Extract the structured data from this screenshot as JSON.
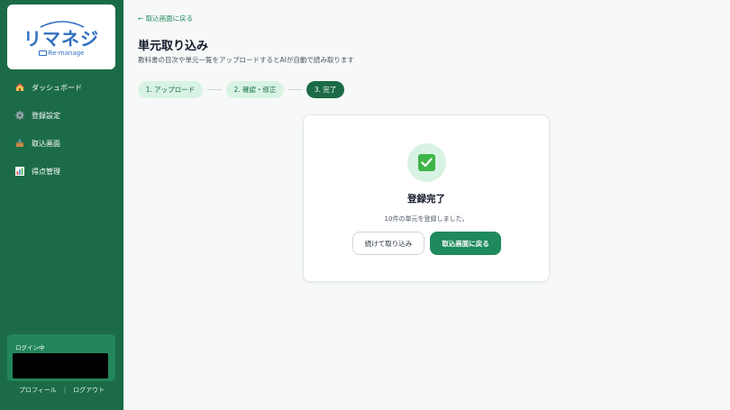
{
  "sidebar": {
    "logo": {
      "main": "リマネジ",
      "sub": "Re-manage"
    },
    "items": [
      {
        "label": "ダッシュボード",
        "icon": "house-icon"
      },
      {
        "label": "登録設定",
        "icon": "gear-icon"
      },
      {
        "label": "取込画面",
        "icon": "inbox-tray-icon"
      },
      {
        "label": "得点管理",
        "icon": "bar-chart-icon"
      }
    ],
    "login": {
      "label": "ログイン中"
    },
    "links": {
      "profile": "プロフィール",
      "logout": "ログアウト"
    }
  },
  "main": {
    "back_link": "← 取込画面に戻る",
    "title": "単元取り込み",
    "description": "教科書の目次や単元一覧をアップロードするとAIが自動で読み取ります",
    "steps": [
      {
        "label": "1. アップロード",
        "state": "done"
      },
      {
        "label": "2. 確認・修正",
        "state": "done"
      },
      {
        "label": "3. 完了",
        "state": "active"
      }
    ],
    "result": {
      "title": "登録完了",
      "message": "10件の単元を登録しました。",
      "continue_button": "続けて取り込み",
      "back_button": "取込画面に戻る"
    }
  },
  "colors": {
    "sidebar": "#1b6b47",
    "accent": "#1f8a5c",
    "step_done_bg": "#d8f3e3",
    "check": "#3fb449"
  }
}
